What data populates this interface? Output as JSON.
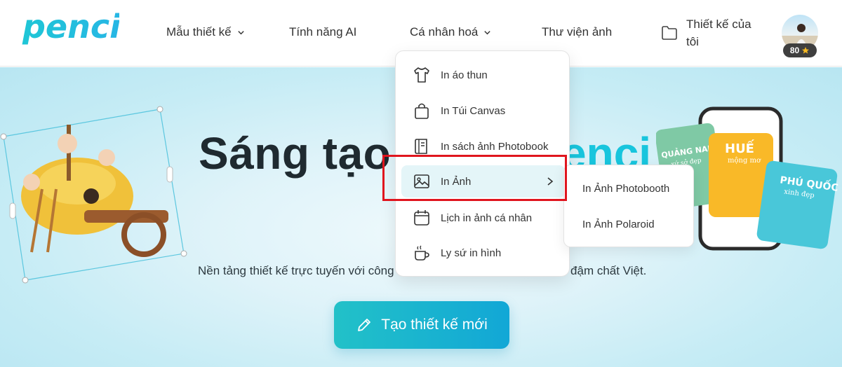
{
  "brand": {
    "logo_text": "penci",
    "color": "#22c1d8"
  },
  "nav": {
    "templates": "Mẫu thiết kế",
    "ai_features": "Tính năng AI",
    "personalize": "Cá nhân hoá",
    "library": "Thư viện ảnh",
    "my_designs": "Thiết kế của tôi"
  },
  "user": {
    "coins": "80",
    "coin_icon": "star-icon"
  },
  "dropdown": {
    "items": [
      {
        "label": "In áo thun",
        "icon": "tshirt-icon"
      },
      {
        "label": "In Túi Canvas",
        "icon": "bag-icon"
      },
      {
        "label": "In sách ảnh Photobook",
        "icon": "book-icon"
      },
      {
        "label": "In Ảnh",
        "icon": "image-icon"
      },
      {
        "label": "Lịch in ảnh cá nhân",
        "icon": "calendar-icon"
      },
      {
        "label": "Ly sứ in hình",
        "icon": "mug-icon"
      }
    ],
    "active_index": 3
  },
  "submenu": {
    "items": [
      "In Ảnh Photobooth",
      "In Ảnh Polaroid"
    ]
  },
  "hero": {
    "title": "Sáng tạo",
    "brand_word": "enci",
    "subtitle": "Nền tảng thiết kế trực tuyến với công",
    "subtitle_end": "đậm chất Việt.",
    "cta": "Tạo thiết kế mới"
  },
  "cards": {
    "card1": "QUẢNG NAM",
    "card1_sub": "xứ sở đẹp",
    "card2": "HUẾ",
    "card2_sub": "mộng mơ",
    "card3": "PHÚ QUỐC",
    "card3_sub": "xinh đẹp"
  },
  "colors": {
    "accent": "#18c5dd",
    "cta_start": "#22c1c8",
    "cta_end": "#12a7d6",
    "highlight": "#e0151e"
  }
}
